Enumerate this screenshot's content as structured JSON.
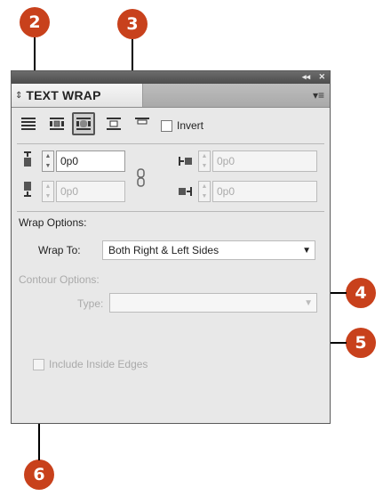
{
  "callouts": {
    "c2": "2",
    "c3": "3",
    "c4": "4",
    "c5": "5",
    "c6": "6"
  },
  "titlebar": {
    "collapse_glyph": "◂◂",
    "close_glyph": "✕"
  },
  "panel": {
    "title": "TEXT WRAP",
    "collapse_glyph": "⇕",
    "menu_glyph": "▾≡"
  },
  "wrap_types": {
    "invert_label": "Invert"
  },
  "offsets": {
    "top": "0p0",
    "bottom": "0p0",
    "left": "0p0",
    "right": "0p0"
  },
  "wrap_options": {
    "section_label": "Wrap Options:",
    "wrap_to_label": "Wrap To:",
    "wrap_to_value": "Both Right & Left Sides"
  },
  "contour_options": {
    "section_label": "Contour Options:",
    "type_label": "Type:",
    "type_value": ""
  },
  "include_inside_edges_label": "Include Inside Edges",
  "colors": {
    "callout": "#c8411c",
    "panel_bg": "#e8e8e8"
  }
}
